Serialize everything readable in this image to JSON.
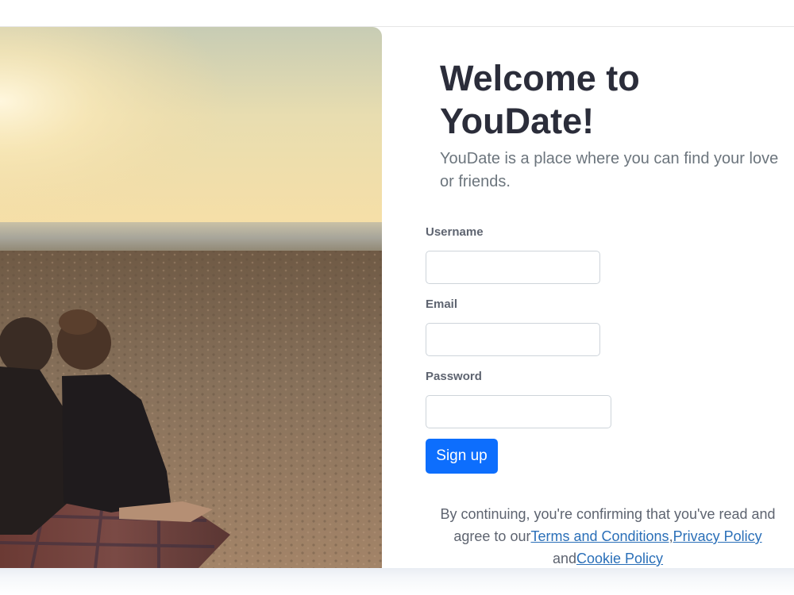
{
  "hero": {
    "title": "Welcome to YouDate!",
    "subtitle": "YouDate is a place where you can find your love or friends."
  },
  "form": {
    "username": {
      "label": "Username",
      "value": "",
      "placeholder": ""
    },
    "email": {
      "label": "Email",
      "value": "",
      "placeholder": ""
    },
    "password": {
      "label": "Password",
      "value": "",
      "placeholder": ""
    },
    "submit_label": "Sign up"
  },
  "terms": {
    "prefix": "By continuing, you're confirming that you've read and agree to our",
    "terms_link": "Terms and Conditions",
    "separator": ",",
    "privacy_link": "Privacy Policy",
    "and_text": "and",
    "cookie_link": "Cookie Policy"
  },
  "colors": {
    "primary": "#0d6efd",
    "heading": "#2b2d3a",
    "muted": "#6c757d",
    "link": "#2a6fb8"
  }
}
